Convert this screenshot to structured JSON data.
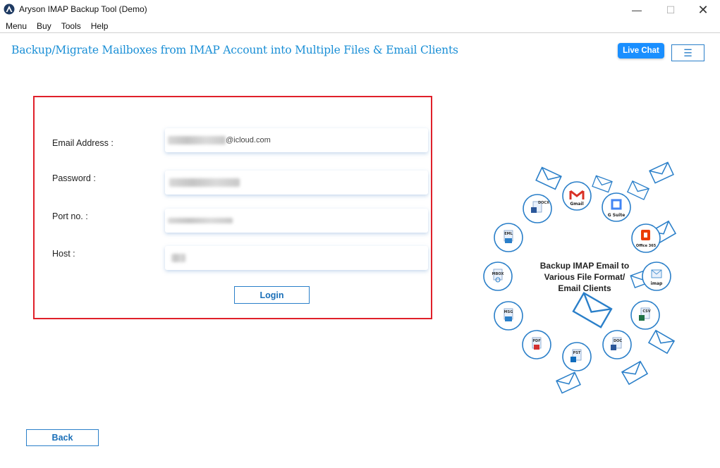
{
  "window": {
    "title": "Aryson IMAP Backup Tool (Demo)",
    "minimize": "—",
    "maximize": "☐",
    "close": "✕"
  },
  "menu": [
    "Menu",
    "Buy",
    "Tools",
    "Help"
  ],
  "header": {
    "heading": "Backup/Migrate Mailboxes from IMAP Account into Multiple Files & Email Clients",
    "live_chat": "Live Chat",
    "hamburger": "☰"
  },
  "form": {
    "email_label": "Email Address :",
    "email_value_suffix": "@icloud.com",
    "password_label": "Password  :",
    "port_label": "Port no. :",
    "host_label": "Host :",
    "login": "Login"
  },
  "footer": {
    "back": "Back"
  },
  "illustration": {
    "line1": "Backup IMAP Email to",
    "line2": "Various File Format/",
    "line3": "Email Clients",
    "badges": [
      "DOCX",
      "Gmail",
      "G Suite",
      "EML",
      "Office 365",
      "MBOX",
      "imap",
      "MSG",
      "CSV",
      "PDF",
      "PST",
      "DOC"
    ]
  },
  "colors": {
    "accent": "#1a8fd6",
    "button_border": "#2a7fc9",
    "highlight_box": "#e0202a",
    "live_chat_bg": "#1a8fff"
  }
}
